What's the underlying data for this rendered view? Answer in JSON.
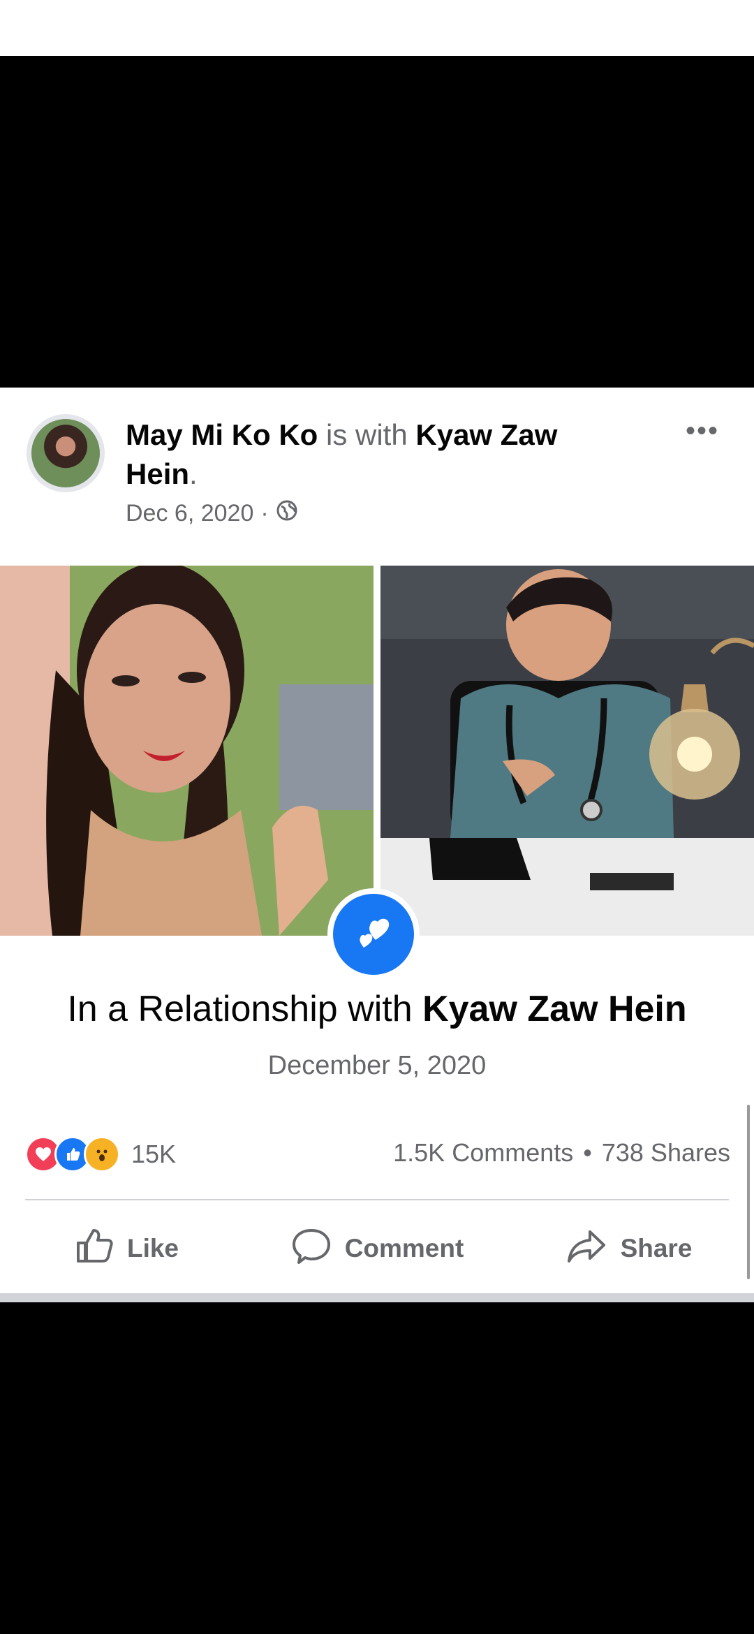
{
  "post": {
    "author": "May Mi Ko Ko",
    "with_text": " is with ",
    "tagged_first": "Kyaw Zaw",
    "tagged_second": "Hein",
    "period": ".",
    "date": "Dec 6, 2020",
    "separator": "·",
    "privacy_icon": "globe-icon",
    "more_label": "•••",
    "relationship_prefix": "In a Relationship with ",
    "relationship_partner": "Kyaw Zaw Hein",
    "relationship_date": "December 5, 2020",
    "reaction_icons": [
      "love-icon",
      "like-icon",
      "wow-icon"
    ],
    "reaction_count": "15K",
    "comments": "1.5K Comments",
    "shares": "738 Shares",
    "stats_separator": "•",
    "actions": {
      "like": "Like",
      "comment": "Comment",
      "share": "Share"
    }
  },
  "colors": {
    "accent": "#1877f2",
    "love": "#f33e58",
    "wow": "#f7b125",
    "muted": "#65676b"
  }
}
